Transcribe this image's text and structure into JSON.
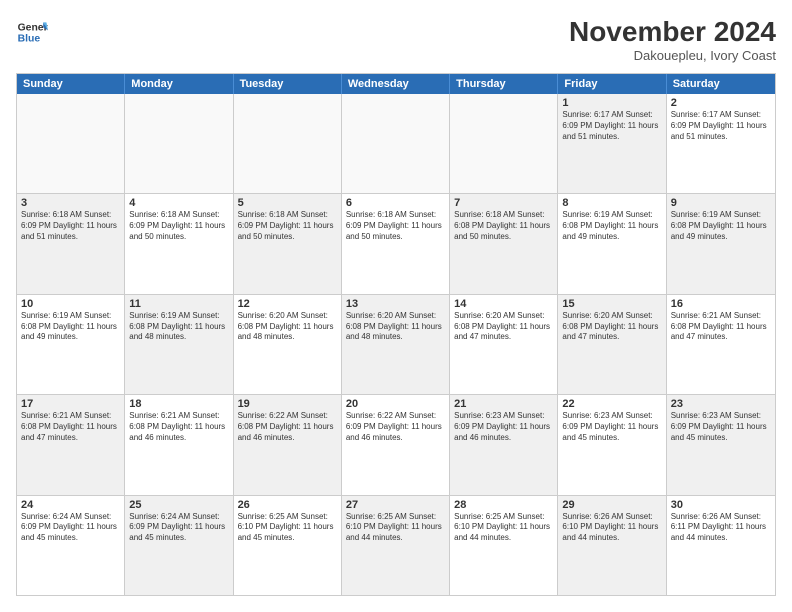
{
  "header": {
    "logo_line1": "General",
    "logo_line2": "Blue",
    "month_title": "November 2024",
    "location": "Dakouepleu, Ivory Coast"
  },
  "day_headers": [
    "Sunday",
    "Monday",
    "Tuesday",
    "Wednesday",
    "Thursday",
    "Friday",
    "Saturday"
  ],
  "weeks": [
    [
      {
        "day": "",
        "info": "",
        "empty": true
      },
      {
        "day": "",
        "info": "",
        "empty": true
      },
      {
        "day": "",
        "info": "",
        "empty": true
      },
      {
        "day": "",
        "info": "",
        "empty": true
      },
      {
        "day": "",
        "info": "",
        "empty": true
      },
      {
        "day": "1",
        "info": "Sunrise: 6:17 AM\nSunset: 6:09 PM\nDaylight: 11 hours and 51 minutes.",
        "empty": false,
        "shaded": true
      },
      {
        "day": "2",
        "info": "Sunrise: 6:17 AM\nSunset: 6:09 PM\nDaylight: 11 hours and 51 minutes.",
        "empty": false,
        "shaded": false
      }
    ],
    [
      {
        "day": "3",
        "info": "Sunrise: 6:18 AM\nSunset: 6:09 PM\nDaylight: 11 hours and 51 minutes.",
        "empty": false,
        "shaded": true
      },
      {
        "day": "4",
        "info": "Sunrise: 6:18 AM\nSunset: 6:09 PM\nDaylight: 11 hours and 50 minutes.",
        "empty": false,
        "shaded": false
      },
      {
        "day": "5",
        "info": "Sunrise: 6:18 AM\nSunset: 6:09 PM\nDaylight: 11 hours and 50 minutes.",
        "empty": false,
        "shaded": true
      },
      {
        "day": "6",
        "info": "Sunrise: 6:18 AM\nSunset: 6:09 PM\nDaylight: 11 hours and 50 minutes.",
        "empty": false,
        "shaded": false
      },
      {
        "day": "7",
        "info": "Sunrise: 6:18 AM\nSunset: 6:08 PM\nDaylight: 11 hours and 50 minutes.",
        "empty": false,
        "shaded": true
      },
      {
        "day": "8",
        "info": "Sunrise: 6:19 AM\nSunset: 6:08 PM\nDaylight: 11 hours and 49 minutes.",
        "empty": false,
        "shaded": false
      },
      {
        "day": "9",
        "info": "Sunrise: 6:19 AM\nSunset: 6:08 PM\nDaylight: 11 hours and 49 minutes.",
        "empty": false,
        "shaded": true
      }
    ],
    [
      {
        "day": "10",
        "info": "Sunrise: 6:19 AM\nSunset: 6:08 PM\nDaylight: 11 hours and 49 minutes.",
        "empty": false,
        "shaded": false
      },
      {
        "day": "11",
        "info": "Sunrise: 6:19 AM\nSunset: 6:08 PM\nDaylight: 11 hours and 48 minutes.",
        "empty": false,
        "shaded": true
      },
      {
        "day": "12",
        "info": "Sunrise: 6:20 AM\nSunset: 6:08 PM\nDaylight: 11 hours and 48 minutes.",
        "empty": false,
        "shaded": false
      },
      {
        "day": "13",
        "info": "Sunrise: 6:20 AM\nSunset: 6:08 PM\nDaylight: 11 hours and 48 minutes.",
        "empty": false,
        "shaded": true
      },
      {
        "day": "14",
        "info": "Sunrise: 6:20 AM\nSunset: 6:08 PM\nDaylight: 11 hours and 47 minutes.",
        "empty": false,
        "shaded": false
      },
      {
        "day": "15",
        "info": "Sunrise: 6:20 AM\nSunset: 6:08 PM\nDaylight: 11 hours and 47 minutes.",
        "empty": false,
        "shaded": true
      },
      {
        "day": "16",
        "info": "Sunrise: 6:21 AM\nSunset: 6:08 PM\nDaylight: 11 hours and 47 minutes.",
        "empty": false,
        "shaded": false
      }
    ],
    [
      {
        "day": "17",
        "info": "Sunrise: 6:21 AM\nSunset: 6:08 PM\nDaylight: 11 hours and 47 minutes.",
        "empty": false,
        "shaded": true
      },
      {
        "day": "18",
        "info": "Sunrise: 6:21 AM\nSunset: 6:08 PM\nDaylight: 11 hours and 46 minutes.",
        "empty": false,
        "shaded": false
      },
      {
        "day": "19",
        "info": "Sunrise: 6:22 AM\nSunset: 6:08 PM\nDaylight: 11 hours and 46 minutes.",
        "empty": false,
        "shaded": true
      },
      {
        "day": "20",
        "info": "Sunrise: 6:22 AM\nSunset: 6:09 PM\nDaylight: 11 hours and 46 minutes.",
        "empty": false,
        "shaded": false
      },
      {
        "day": "21",
        "info": "Sunrise: 6:23 AM\nSunset: 6:09 PM\nDaylight: 11 hours and 46 minutes.",
        "empty": false,
        "shaded": true
      },
      {
        "day": "22",
        "info": "Sunrise: 6:23 AM\nSunset: 6:09 PM\nDaylight: 11 hours and 45 minutes.",
        "empty": false,
        "shaded": false
      },
      {
        "day": "23",
        "info": "Sunrise: 6:23 AM\nSunset: 6:09 PM\nDaylight: 11 hours and 45 minutes.",
        "empty": false,
        "shaded": true
      }
    ],
    [
      {
        "day": "24",
        "info": "Sunrise: 6:24 AM\nSunset: 6:09 PM\nDaylight: 11 hours and 45 minutes.",
        "empty": false,
        "shaded": false
      },
      {
        "day": "25",
        "info": "Sunrise: 6:24 AM\nSunset: 6:09 PM\nDaylight: 11 hours and 45 minutes.",
        "empty": false,
        "shaded": true
      },
      {
        "day": "26",
        "info": "Sunrise: 6:25 AM\nSunset: 6:10 PM\nDaylight: 11 hours and 45 minutes.",
        "empty": false,
        "shaded": false
      },
      {
        "day": "27",
        "info": "Sunrise: 6:25 AM\nSunset: 6:10 PM\nDaylight: 11 hours and 44 minutes.",
        "empty": false,
        "shaded": true
      },
      {
        "day": "28",
        "info": "Sunrise: 6:25 AM\nSunset: 6:10 PM\nDaylight: 11 hours and 44 minutes.",
        "empty": false,
        "shaded": false
      },
      {
        "day": "29",
        "info": "Sunrise: 6:26 AM\nSunset: 6:10 PM\nDaylight: 11 hours and 44 minutes.",
        "empty": false,
        "shaded": true
      },
      {
        "day": "30",
        "info": "Sunrise: 6:26 AM\nSunset: 6:11 PM\nDaylight: 11 hours and 44 minutes.",
        "empty": false,
        "shaded": false
      }
    ]
  ]
}
